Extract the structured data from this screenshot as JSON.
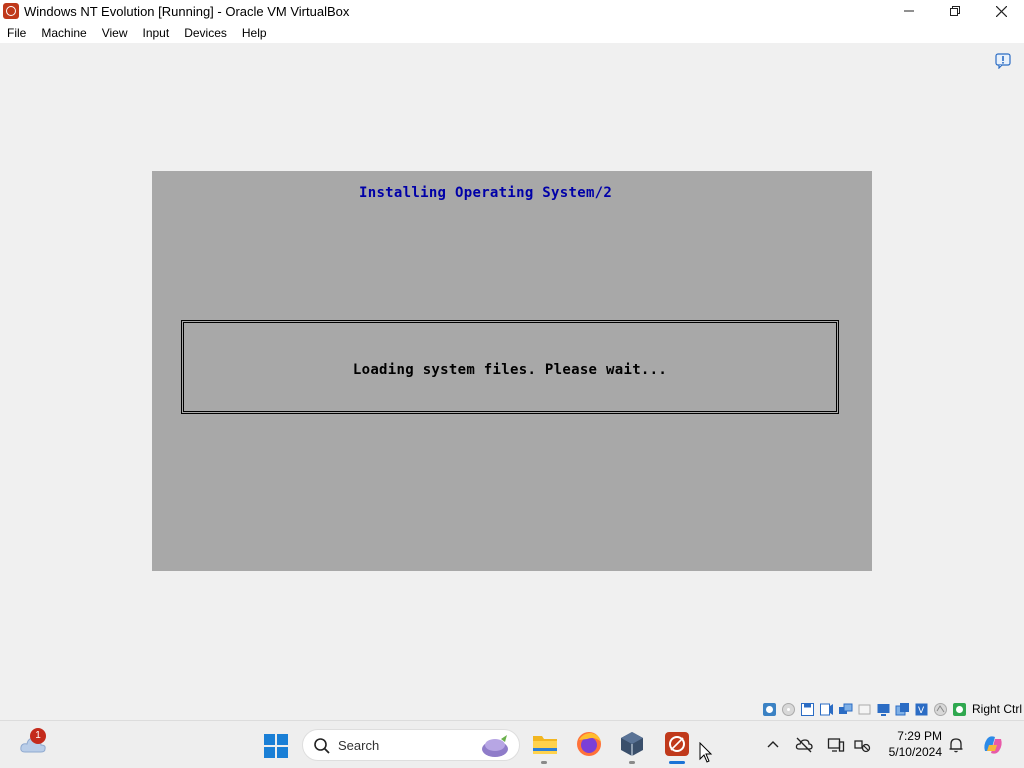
{
  "window": {
    "title": "Windows NT Evolution [Running] - Oracle VM VirtualBox",
    "icon": "virtualbox-vm-icon",
    "controls": [
      "minimize-icon",
      "maximize-icon",
      "close-icon"
    ]
  },
  "menu": {
    "items": [
      "File",
      "Machine",
      "View",
      "Input",
      "Devices",
      "Help"
    ]
  },
  "vm_display": {
    "heading": "Installing Operating System/2",
    "message": "Loading system files. Please wait...",
    "background_color": "#a8a8a8",
    "heading_color": "#0000a8"
  },
  "status_bar": {
    "icons": [
      "hard-disk-icon",
      "optical-drive-icon",
      "floppy-icon",
      "audio-icon",
      "network-icon",
      "usb-icon",
      "shared-folders-icon",
      "display-icon",
      "recording-icon",
      "cpu-icon",
      "mouse-integration-icon",
      "keyboard-icon"
    ],
    "host_key": "Right Ctrl"
  },
  "taskbar": {
    "weather_badge": "1",
    "search_placeholder": "Search",
    "apps": [
      "file-explorer-icon",
      "firefox-icon",
      "virtualbox-manager-icon",
      "virtualbox-vm-icon"
    ],
    "clock": {
      "time": "7:29 PM",
      "date": "5/10/2024"
    }
  }
}
